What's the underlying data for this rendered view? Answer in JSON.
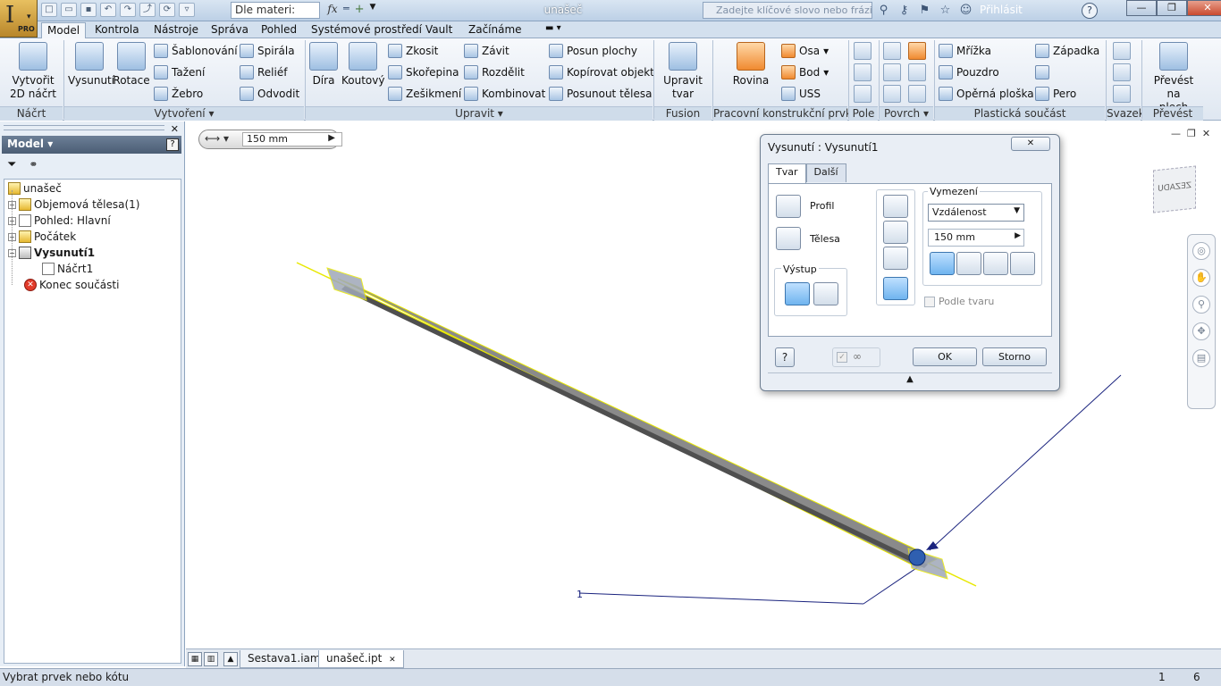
{
  "titlebar": {
    "app_badge": "PRO",
    "material": "Dle materi:",
    "document_title": "unašeč",
    "search_placeholder": "Zadejte klíčové slovo nebo frázi",
    "sign_in": "Přihlásit"
  },
  "tabs": [
    "Model",
    "Kontrola",
    "Nástroje",
    "Správa",
    "Pohled",
    "Systémové prostředí",
    "Vault",
    "Začínáme"
  ],
  "ribbon": {
    "nacrt": {
      "create_2d": [
        "Vytvořit",
        "2D náčrt"
      ],
      "panel": "Náčrt"
    },
    "vytvoreni": {
      "extrude": "Vysunutí",
      "revolve": "Rotace",
      "small": [
        "Šablonování",
        "Tažení",
        "Žebro",
        "Spirála",
        "Reliéf",
        "Odvodit"
      ],
      "panel": "Vytvoření"
    },
    "upravit": {
      "big": [
        "Díra",
        "Koutový"
      ],
      "small": [
        "Zkosit",
        "Skořepina",
        "Zešikmení",
        "Závit",
        "Rozdělit",
        "Kombinovat",
        "Posun plochy",
        "Kopírovat objekt",
        "Posunout tělesa"
      ],
      "panel": "Upravit"
    },
    "fusion": {
      "edit_form": [
        "Upravit",
        "tvar"
      ],
      "panel": "Fusion"
    },
    "pracovni": {
      "plane": "Rovina",
      "small": [
        "Osa",
        "Bod",
        "USS"
      ],
      "panel": "Pracovní konstrukční prvky"
    },
    "pole": {
      "panel": "Pole"
    },
    "povrch": {
      "panel": "Povrch"
    },
    "plasticka": {
      "small": [
        "Mřížka",
        "Pouzdro",
        "Opěrná ploška",
        "Západka",
        "Pero"
      ],
      "panel": "Plastická součást"
    },
    "svazek": {
      "panel": "Svazek"
    },
    "prevest": {
      "convert": [
        "Převést na",
        "plech"
      ],
      "panel": "Převést"
    }
  },
  "browser": {
    "title": "Model",
    "tree": [
      {
        "label": "unašeč",
        "level": 0
      },
      {
        "label": "Objemová tělesa(1)",
        "level": 1
      },
      {
        "label": "Pohled: Hlavní",
        "level": 1
      },
      {
        "label": "Počátek",
        "level": 1
      },
      {
        "label": "Vysunutí1",
        "level": 1
      },
      {
        "label": "Náčrt1",
        "level": 2
      },
      {
        "label": "Konec součásti",
        "level": 1
      }
    ]
  },
  "canvas": {
    "distance_value": "150 mm",
    "viewcube_label": "ZEZADU",
    "dimension_label": "1"
  },
  "dialog": {
    "title": "Vysunutí : Vysunutí1",
    "tabs": [
      "Tvar",
      "Další"
    ],
    "profile": "Profil",
    "solids": "Tělesa",
    "output": "Výstup",
    "extents": "Vymezení",
    "extent_type": "Vzdálenost",
    "distance": "150 mm",
    "match_shape": "Podle tvaru",
    "ok": "OK",
    "cancel": "Storno"
  },
  "doc_tabs": [
    "Sestava1.iam",
    "unašeč.ipt"
  ],
  "status": {
    "prompt": "Vybrat prvek nebo kótu",
    "count1": "1",
    "count2": "6"
  },
  "colors": {
    "ribbon_bg": "#dfe7f1",
    "selection_yellow": "#e8e800",
    "sketch_blue": "#1a237e"
  }
}
